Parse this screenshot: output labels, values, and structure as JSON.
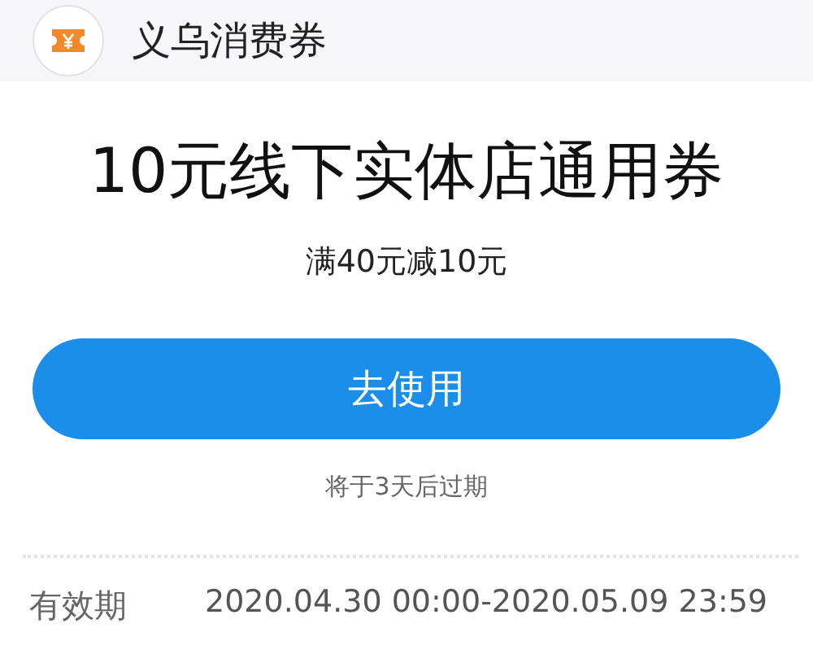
{
  "header": {
    "title": "义乌消费券"
  },
  "coupon": {
    "title": "10元线下实体店通用券",
    "condition": "满40元减10元",
    "button": "去使用",
    "expiry_note": "将于3天后过期"
  },
  "details": [
    {
      "label": "有效期",
      "value": "2020.04.30 00:00-2020.05.09 23:59"
    }
  ]
}
